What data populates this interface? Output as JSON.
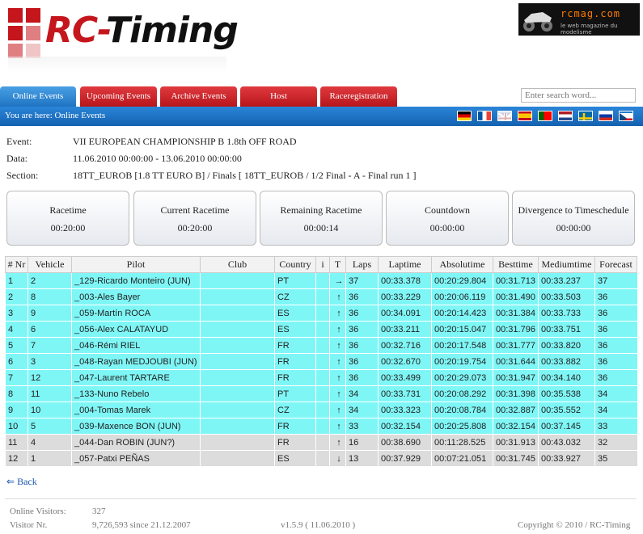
{
  "brand": {
    "rc": "RC",
    "dash": "-",
    "timing": "Timing"
  },
  "ad": {
    "name": "rcmag.com",
    "tagline": "le web magazine du modelisme"
  },
  "tabs": [
    {
      "label": "Online Events",
      "active": true
    },
    {
      "label": "Upcoming Events"
    },
    {
      "label": "Archive Events"
    },
    {
      "label": "Host"
    },
    {
      "label": "Raceregistration"
    }
  ],
  "search": {
    "placeholder": "Enter search word..."
  },
  "breadcrumb": "You are here: Online Events",
  "flags": [
    "de",
    "fr",
    "gb",
    "es",
    "pt",
    "nl",
    "se",
    "ru",
    "cz"
  ],
  "event": {
    "event_label": "Event:",
    "event_value": "VII EUROPEAN CHAMPIONSHIP B 1.8th OFF ROAD",
    "date_label": "Data:",
    "date_value": "11.06.2010 00:00:00 - 13.06.2010 00:00:00",
    "section_label": "Section:",
    "section_value": "18TT_EUROB [1.8 TT EURO B] / Finals [ 18TT_EUROB / 1/2 Final - A - Final run 1 ]"
  },
  "timers": [
    {
      "title": "Racetime",
      "value": "00:20:00"
    },
    {
      "title": "Current Racetime",
      "value": "00:20:00"
    },
    {
      "title": "Remaining Racetime",
      "value": "00:00:14"
    },
    {
      "title": "Countdown",
      "value": "00:00:00"
    },
    {
      "title": "Divergence to Timeschedule",
      "value": "00:00:00"
    }
  ],
  "table": {
    "headers": [
      "# Nr",
      "Vehicle",
      "Pilot",
      "Club",
      "Country",
      "i",
      "T",
      "Laps",
      "Laptime",
      "Absolutime",
      "Besttime",
      "Mediumtime",
      "Forecast"
    ],
    "rows": [
      {
        "nr": "1",
        "veh": "2",
        "pilot": "_129-Ricardo Monteiro (JUN)",
        "club": "",
        "country": "PT",
        "i": "",
        "t": "→",
        "laps": "37",
        "lap": "00:33.378",
        "abs": "00:20:29.804",
        "best": "00:31.713",
        "med": "00:33.237",
        "fc": "37",
        "style": "cyan"
      },
      {
        "nr": "2",
        "veh": "8",
        "pilot": "_003-Ales Bayer",
        "club": "",
        "country": "CZ",
        "i": "",
        "t": "↑",
        "laps": "36",
        "lap": "00:33.229",
        "abs": "00:20:06.119",
        "best": "00:31.490",
        "med": "00:33.503",
        "fc": "36",
        "style": "cyan"
      },
      {
        "nr": "3",
        "veh": "9",
        "pilot": "_059-Martín ROCA",
        "club": "",
        "country": "ES",
        "i": "",
        "t": "↑",
        "laps": "36",
        "lap": "00:34.091",
        "abs": "00:20:14.423",
        "best": "00:31.384",
        "med": "00:33.733",
        "fc": "36",
        "style": "cyan"
      },
      {
        "nr": "4",
        "veh": "6",
        "pilot": "_056-Alex CALATAYUD",
        "club": "",
        "country": "ES",
        "i": "",
        "t": "↑",
        "laps": "36",
        "lap": "00:33.211",
        "abs": "00:20:15.047",
        "best": "00:31.796",
        "med": "00:33.751",
        "fc": "36",
        "style": "cyan"
      },
      {
        "nr": "5",
        "veh": "7",
        "pilot": "_046-Rémi RIEL",
        "club": "",
        "country": "FR",
        "i": "",
        "t": "↑",
        "laps": "36",
        "lap": "00:32.716",
        "abs": "00:20:17.548",
        "best": "00:31.777",
        "med": "00:33.820",
        "fc": "36",
        "style": "cyan"
      },
      {
        "nr": "6",
        "veh": "3",
        "pilot": "_048-Rayan MEDJOUBI (JUN)",
        "club": "",
        "country": "FR",
        "i": "",
        "t": "↑",
        "laps": "36",
        "lap": "00:32.670",
        "abs": "00:20:19.754",
        "best": "00:31.644",
        "med": "00:33.882",
        "fc": "36",
        "style": "cyan"
      },
      {
        "nr": "7",
        "veh": "12",
        "pilot": "_047-Laurent TARTARE",
        "club": "",
        "country": "FR",
        "i": "",
        "t": "↑",
        "laps": "36",
        "lap": "00:33.499",
        "abs": "00:20:29.073",
        "best": "00:31.947",
        "med": "00:34.140",
        "fc": "36",
        "style": "cyan"
      },
      {
        "nr": "8",
        "veh": "11",
        "pilot": "_133-Nuno Rebelo",
        "club": "",
        "country": "PT",
        "i": "",
        "t": "↑",
        "laps": "34",
        "lap": "00:33.731",
        "abs": "00:20:08.292",
        "best": "00:31.398",
        "med": "00:35.538",
        "fc": "34",
        "style": "cyan"
      },
      {
        "nr": "9",
        "veh": "10",
        "pilot": "_004-Tomas Marek",
        "club": "",
        "country": "CZ",
        "i": "",
        "t": "↑",
        "laps": "34",
        "lap": "00:33.323",
        "abs": "00:20:08.784",
        "best": "00:32.887",
        "med": "00:35.552",
        "fc": "34",
        "style": "cyan"
      },
      {
        "nr": "10",
        "veh": "5",
        "pilot": "_039-Maxence BON (JUN)",
        "club": "",
        "country": "FR",
        "i": "",
        "t": "↑",
        "laps": "33",
        "lap": "00:32.154",
        "abs": "00:20:25.808",
        "best": "00:32.154",
        "med": "00:37.145",
        "fc": "33",
        "style": "cyan"
      },
      {
        "nr": "11",
        "veh": "4",
        "pilot": "_044-Dan ROBIN (JUN?)",
        "club": "",
        "country": "FR",
        "i": "",
        "t": "↑",
        "laps": "16",
        "lap": "00:38.690",
        "abs": "00:11:28.525",
        "best": "00:31.913",
        "med": "00:43.032",
        "fc": "32",
        "style": "grey"
      },
      {
        "nr": "12",
        "veh": "1",
        "pilot": "_057-Patxi PEÑAS",
        "club": "",
        "country": "ES",
        "i": "",
        "t": "↓",
        "laps": "13",
        "lap": "00:37.929",
        "abs": "00:07:21.051",
        "best": "00:31.745",
        "med": "00:33.927",
        "fc": "35",
        "style": "grey"
      }
    ]
  },
  "back": {
    "arrow": "⇐",
    "label": "Back"
  },
  "footer": {
    "visitors_label": "Online Visitors:",
    "visitors_value": "327",
    "visitor_nr_label": "Visitor Nr.",
    "visitor_nr_value": "9,726,593 since 21.12.2007",
    "version": "v1.5.9 ( 11.06.2010 )",
    "copyright": "Copyright © 2010 / RC-Timing"
  }
}
